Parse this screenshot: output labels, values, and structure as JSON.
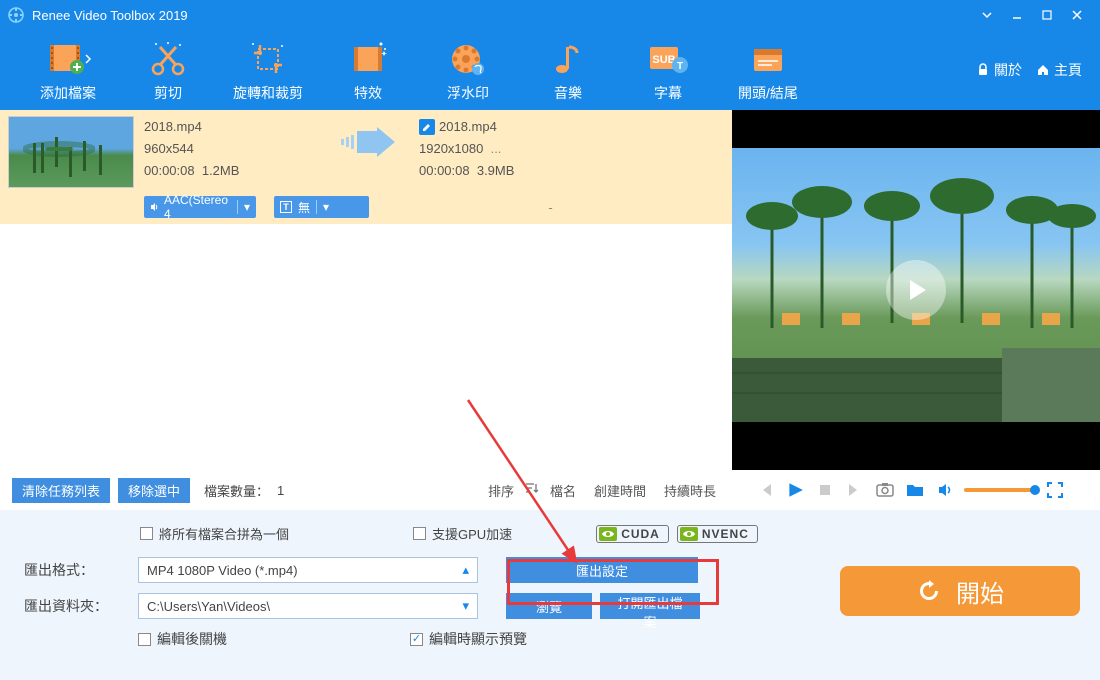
{
  "titlebar": {
    "title": "Renee Video Toolbox 2019"
  },
  "toolbar": {
    "add_file": "添加檔案",
    "cut": "剪切",
    "rotate_crop": "旋轉和裁剪",
    "effects": "特效",
    "watermark": "浮水印",
    "music": "音樂",
    "subtitle": "字幕",
    "intro_outro": "開頭/結尾",
    "about": "關於",
    "home": "主頁"
  },
  "file": {
    "src_name": "2018.mp4",
    "src_res": "960x544",
    "src_dur": "00:00:08",
    "src_size": "1.2MB",
    "out_name": "2018.mp4",
    "out_res": "1920x1080",
    "out_dur": "00:00:08",
    "out_size": "3.9MB",
    "out_etc": "...",
    "audio_sel": "AAC(Stereo 4",
    "sub_prefix": "T",
    "sub_sel": "無",
    "dash": "-"
  },
  "list_ctrl": {
    "clear": "清除任務列表",
    "remove": "移除選中",
    "count_label": "檔案數量：",
    "count_value": "1",
    "sort": "排序",
    "by_name": "檔名",
    "by_created": "創建時間",
    "by_duration": "持續時長"
  },
  "options": {
    "merge": "將所有檔案合拼為一個",
    "gpu": "支援GPU加速",
    "cuda": "CUDA",
    "nvenc": "NVENC",
    "fmt_label": "匯出格式：",
    "fmt_value": "MP4 1080P Video (*.mp4)",
    "export_settings": "匯出設定",
    "folder_label": "匯出資料夾：",
    "folder_value": "C:\\Users\\Yan\\Videos\\",
    "browse": "瀏覽",
    "open_folder": "打開匯出檔案",
    "shutdown": "編輯後關機",
    "preview_after": "編輯時顯示預覽"
  },
  "start": {
    "label": "開始"
  }
}
